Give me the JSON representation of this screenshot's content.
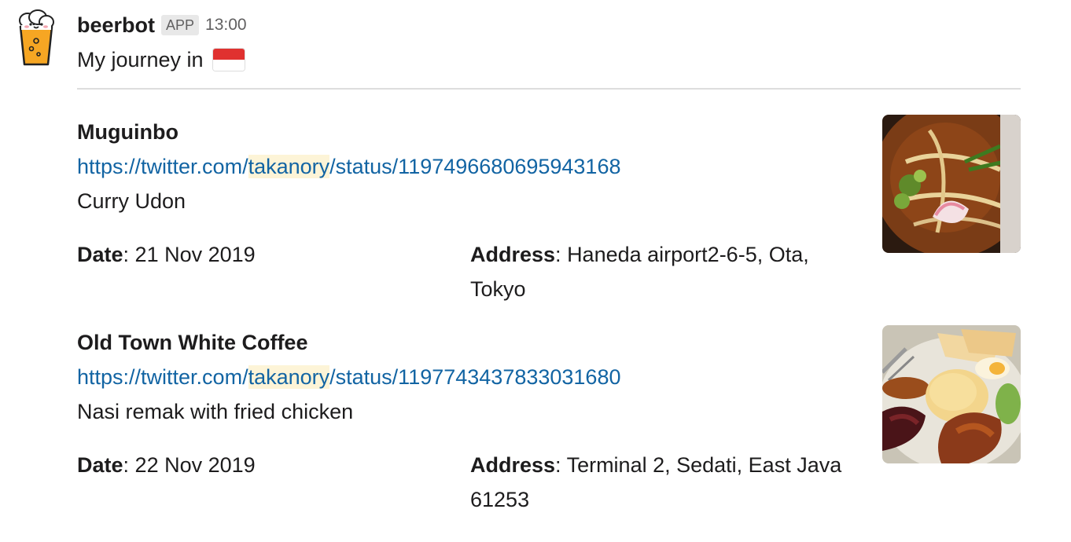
{
  "message": {
    "username": "beerbot",
    "badge": "APP",
    "time": "13:00",
    "intro": "My journey in",
    "flag_icon": "indonesia-flag-icon"
  },
  "colors": {
    "link": "#1264a3",
    "highlight": "#fdf4d7",
    "muted": "#616061"
  },
  "entries": [
    {
      "title": "Muguinbo",
      "link_prefix": "https://twitter.com/",
      "link_highlight": "takanory",
      "link_suffix": "/status/1197496680695943168",
      "description": "Curry Udon",
      "date_label": "Date",
      "date": "21 Nov 2019",
      "address_label": "Address",
      "address": "Haneda airport2-6-5, Ota, Tokyo",
      "thumb_icon": "curry-udon-photo"
    },
    {
      "title": "Old Town White Coffee",
      "link_prefix": "https://twitter.com/",
      "link_highlight": "takanory",
      "link_suffix": "/status/1197743437833031680",
      "description": "Nasi remak with fried chicken",
      "date_label": "Date",
      "date": "22 Nov 2019",
      "address_label": "Address",
      "address": "Terminal 2, Sedati, East Java 61253",
      "thumb_icon": "nasi-lemak-photo"
    }
  ]
}
